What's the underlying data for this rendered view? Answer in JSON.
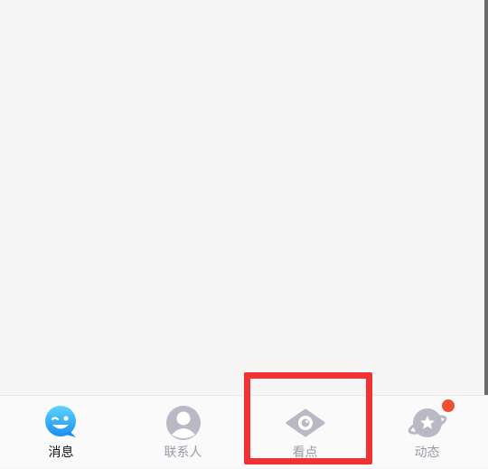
{
  "tabs": [
    {
      "label": "消息",
      "icon": "smiley-chat-icon",
      "active": true
    },
    {
      "label": "联系人",
      "icon": "contact-person-icon",
      "active": false
    },
    {
      "label": "看点",
      "icon": "eye-icon",
      "active": false
    },
    {
      "label": "动态",
      "icon": "planet-star-icon",
      "active": false,
      "badge": true
    }
  ],
  "colors": {
    "active_label": "#111111",
    "inactive": "#9a9aa6",
    "badge": "#f0502e",
    "highlight": "#f13232",
    "accent_blue": "#1ea2f5"
  }
}
